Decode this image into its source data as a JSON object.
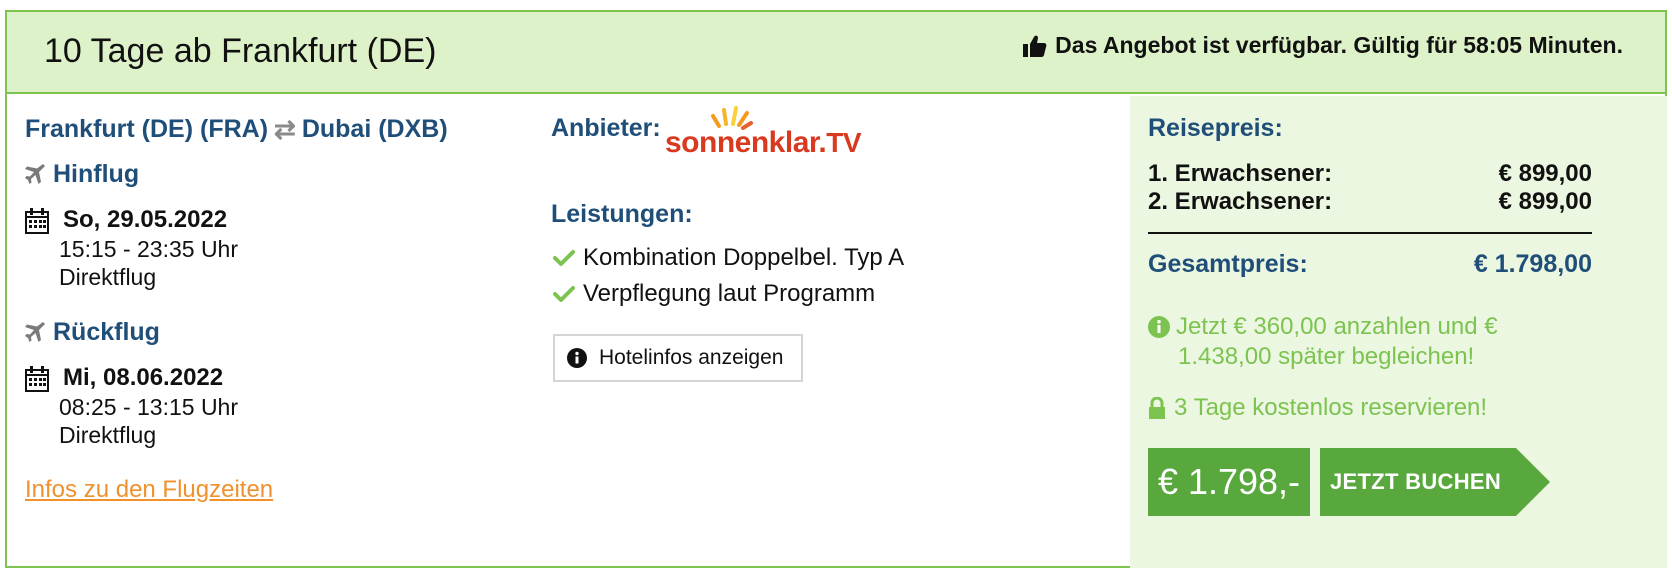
{
  "header": {
    "title": "10 Tage ab Frankfurt (DE)",
    "status": "Das Angebot ist verfügbar. Gültig für 58:05 Minuten.",
    "status_icon": "thumbs-up-icon"
  },
  "flight": {
    "origin": "Frankfurt (DE) (FRA)",
    "swap_symbol": "⇄",
    "destination": "Dubai (DXB)",
    "outbound": {
      "label": "Hinflug",
      "date": "So, 29.05.2022",
      "time": "15:15 - 23:35 Uhr",
      "type": "Direktflug"
    },
    "return": {
      "label": "Rückflug",
      "date": "Mi, 08.06.2022",
      "time": "08:25 - 13:15 Uhr",
      "type": "Direktflug"
    },
    "info_link": "Infos zu den Flugzeiten"
  },
  "provider": {
    "label": "Anbieter:",
    "logo_text_main": "sonnenklar",
    "logo_text_suffix": "TV",
    "services_label": "Leistungen:",
    "services": [
      "Kombination Doppelbel. Typ A",
      "Verpflegung laut Programm"
    ],
    "hotel_button": "Hotelinfos anzeigen"
  },
  "pricing": {
    "label": "Reisepreis:",
    "passengers": [
      {
        "label": "1. Erwachsener:",
        "price": "€ 899,00"
      },
      {
        "label": "2. Erwachsener:",
        "price": "€ 899,00"
      }
    ],
    "total_label": "Gesamtpreis:",
    "total_price": "€ 1.798,00",
    "deposit_line1": "Jetzt € 360,00 anzahlen und €",
    "deposit_line2": "1.438,00 später begleichen!",
    "reserve_text": "3 Tage kostenlos reservieren!",
    "big_price": "€ 1.798,-",
    "book_button": "JETZT BUCHEN"
  },
  "colors": {
    "accent_green": "#7cc350",
    "button_green": "#58a83d",
    "header_bg": "#def2c9",
    "price_bg": "#ebf7e0",
    "heading_blue": "#1f4e79",
    "link_orange": "#f0912d",
    "logo_red": "#d9391f"
  }
}
